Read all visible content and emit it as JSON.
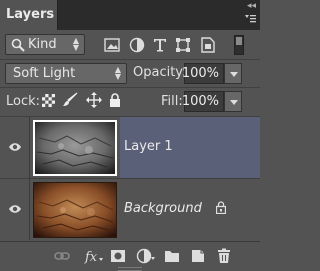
{
  "panel": {
    "title": "Layers"
  },
  "filter": {
    "kind_label": "Kind"
  },
  "blend": {
    "mode": "Soft Light",
    "opacity_label": "Opacity:",
    "opacity_value": "100%"
  },
  "lock": {
    "label": "Lock:",
    "fill_label": "Fill:",
    "fill_value": "100%"
  },
  "layers": [
    {
      "name": "Layer 1",
      "selected": true
    },
    {
      "name": "Background",
      "selected": false,
      "locked": true
    }
  ],
  "colors": {
    "panel_bg": "#535353",
    "selected_row": "#5a6078",
    "titlebar": "#2b2b2b"
  }
}
